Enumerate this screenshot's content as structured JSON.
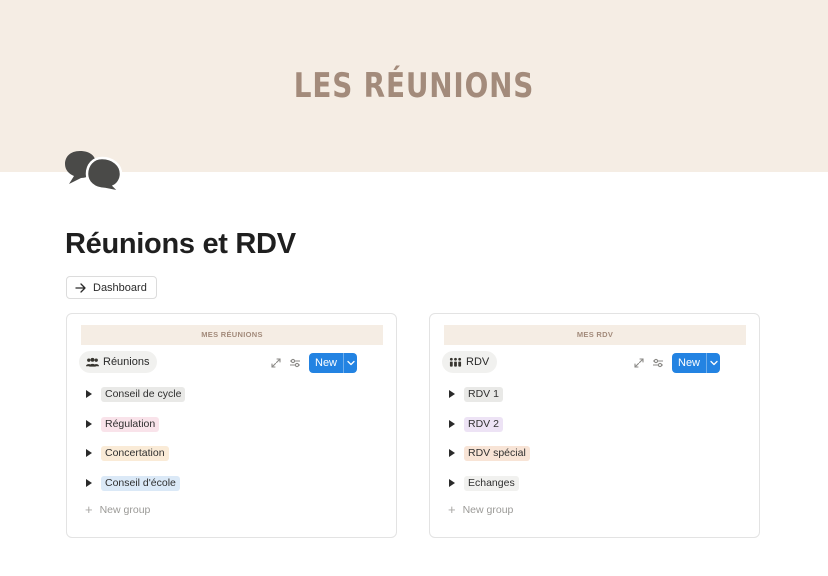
{
  "cover": {
    "title": "LES RÉUNIONS",
    "background": "#f5ede4",
    "title_color": "#a38b7b"
  },
  "page": {
    "icon": "speech-bubbles-icon",
    "title": "Réunions et RDV"
  },
  "dashboard_link": {
    "label": "Dashboard",
    "icon": "arrow-right-icon"
  },
  "panels": [
    {
      "header": "MES RÉUNIONS",
      "view_tab": {
        "label": "Réunions",
        "icon": "people-group-icon"
      },
      "new_button": "New",
      "groups": [
        {
          "label": "Conseil de cycle",
          "color": "#e9e9e7"
        },
        {
          "label": "Régulation",
          "color": "#f9e3ea"
        },
        {
          "label": "Concertation",
          "color": "#faebd7"
        },
        {
          "label": "Conseil d'école",
          "color": "#dbe9f7"
        }
      ],
      "new_group": "New group"
    },
    {
      "header": "MES RDV",
      "view_tab": {
        "label": "RDV",
        "icon": "family-icon"
      },
      "new_button": "New",
      "groups": [
        {
          "label": "RDV 1",
          "color": "#e9e9e7"
        },
        {
          "label": "RDV 2",
          "color": "#ede3f5"
        },
        {
          "label": "RDV spécial",
          "color": "#f8e4d6"
        },
        {
          "label": "Echanges",
          "color": "#f1f1ef"
        }
      ],
      "new_group": "New group"
    }
  ],
  "accent_color": "#2383e2"
}
